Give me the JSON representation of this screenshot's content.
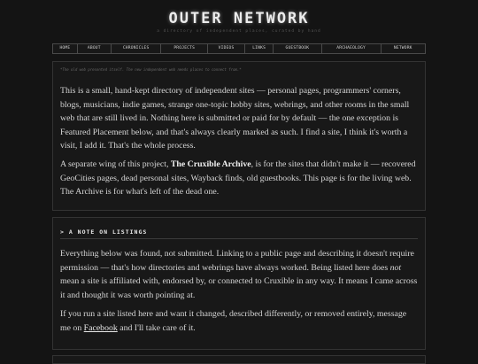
{
  "header": {
    "title": "OUTER NETWORK",
    "tagline": "a directory of independent places, curated by hand"
  },
  "nav": {
    "items": [
      "HOME",
      "ABOUT",
      "CHRONICLES",
      "PROJECTS",
      "VIDEOS",
      "LINKS",
      "GUESTBOOK",
      "ARCHAEOLOGY",
      "NETWORK"
    ]
  },
  "intro": {
    "notice": "*The old web presented itself. The new independent web needs places to connect from.*",
    "para1": "This is a small, hand-kept directory of independent sites — personal pages, programmers' corners, blogs, musicians, indie games, strange one-topic hobby sites, webrings, and other rooms in the small web that are still lived in. Nothing here is submitted or paid for by default — the one exception is Featured Placement below, and that's always clearly marked as such. I find a site, I think it's worth a visit, I add it. That's the whole process.",
    "para2_before": "A separate wing of this project, ",
    "para2_bold": "The Cruxible Archive",
    "para2_after": ", is for the sites that didn't make it — recovered GeoCities pages, dead personal sites, Wayback finds, old guestbooks. This page is for the living web. The Archive is for what's left of the dead one."
  },
  "listings_note": {
    "heading": "> A NOTE ON LISTINGS",
    "para1_before": "Everything below was found, not submitted. Linking to a public page and describing it doesn't require permission — that's how directories and webrings have always worked. Being listed here does ",
    "para1_em": "not",
    "para1_after": " mean a site is affiliated with, endorsed by, or connected to Cruxible in any way. It means I came across it and thought it was worth pointing at.",
    "para2_before": "If you run a site listed here and want it changed, described differently, or removed entirely, message me on ",
    "para2_link": "Facebook",
    "para2_after": " and I'll take care of it."
  }
}
